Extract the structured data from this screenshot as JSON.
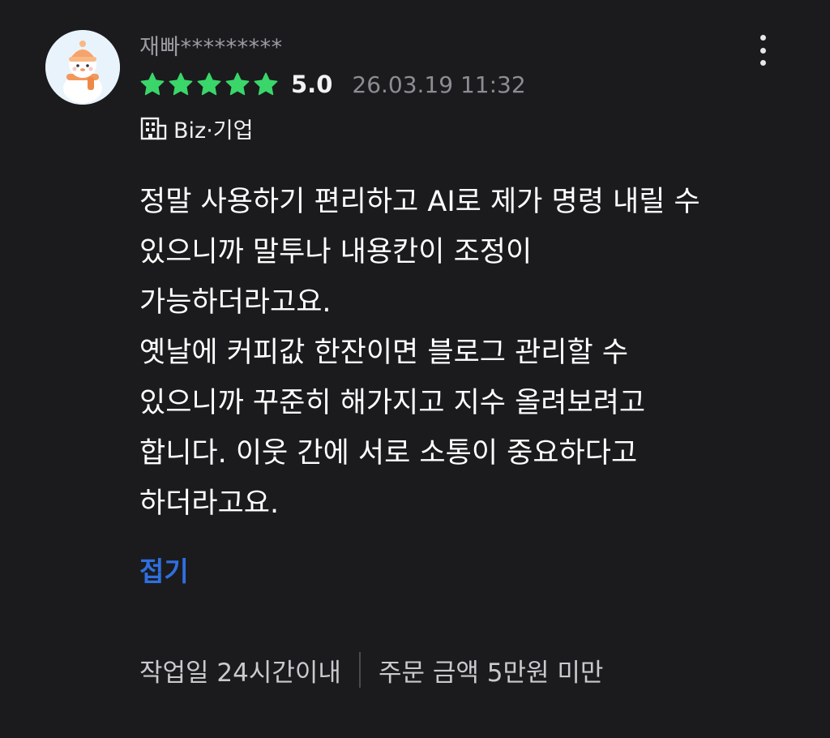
{
  "review": {
    "username": "재빠*********",
    "rating_value": 5.0,
    "star_count": 5,
    "score_label": "5.0",
    "date": "26.03.19 11:32",
    "badge": {
      "icon": "building-icon",
      "label": "Biz·기업"
    },
    "body_lines": [
      "정말 사용하기 편리하고 AI로 제가 명령 내릴 수",
      "있으니까 말투나 내용칸이 조정이",
      "가능하더라고요.",
      "옛날에 커피값 한잔이면 블로그 관리할 수",
      "있으니까 꾸준히 해가지고 지수 올려보려고",
      "합니다. 이웃 간에 서로 소통이 중요하다고",
      "하더라고요."
    ],
    "collapse_label": "접기",
    "meta": {
      "work_period": "작업일 24시간이내",
      "order_amount": "주문 금액 5만원 미만"
    }
  },
  "icons": {
    "avatar": "snowman-avatar",
    "more": "more-vertical-icon",
    "star": "star-icon"
  },
  "colors": {
    "background": "#1b1b1d",
    "star": "#3ad66a",
    "link": "#2f6fe0",
    "muted_text": "#8c8c93"
  }
}
